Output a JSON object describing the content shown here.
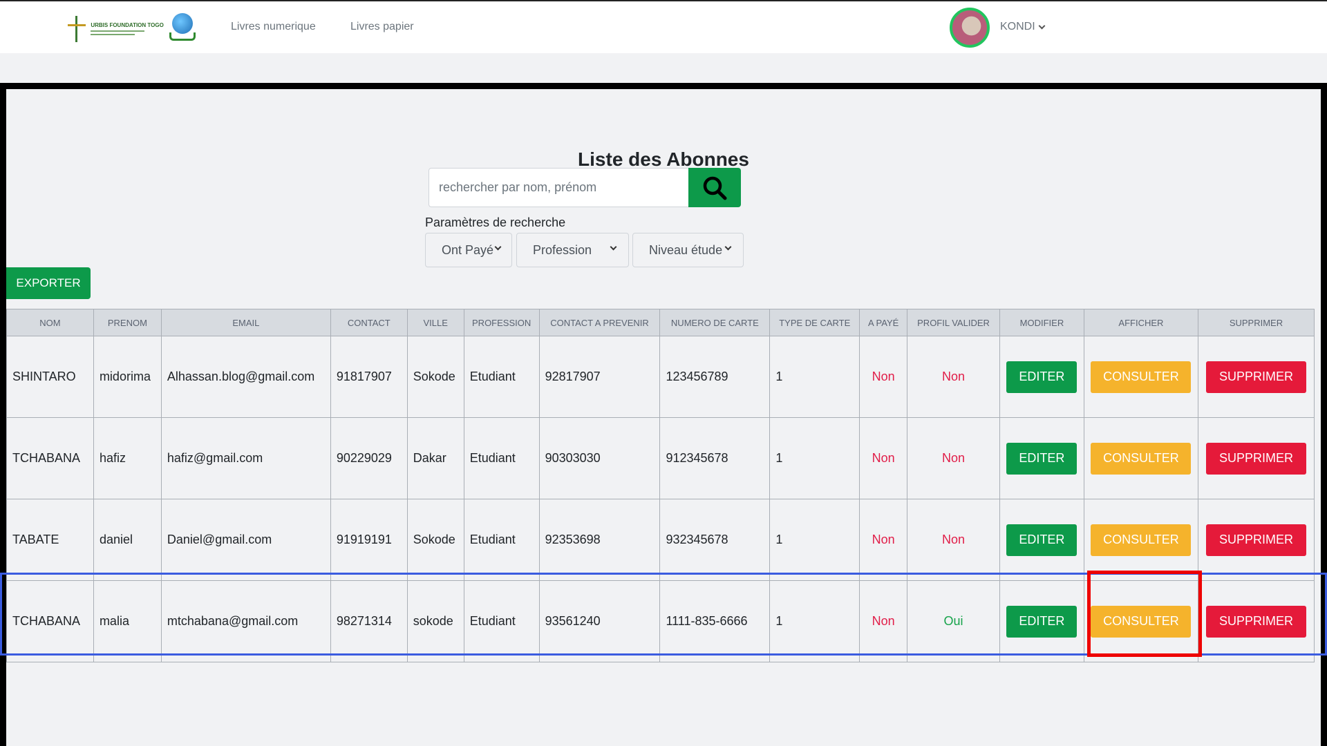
{
  "navbar": {
    "logo": {
      "title": "URBIS FOUNDATION TOGO",
      "icon": "logo-emblem-icon",
      "globe_icon": "globe-book-icon"
    },
    "links": [
      "Livres numerique",
      "Livres papier"
    ],
    "user": {
      "name": "KONDI",
      "avatar_icon": "user-avatar-icon"
    }
  },
  "page": {
    "title": "Liste des Abonnes",
    "search": {
      "placeholder": "rechercher par nom, prénom",
      "value": "",
      "icon": "search-icon"
    },
    "params_label": "Paramètres de recherche",
    "filters": [
      "Ont Payé",
      "Profession",
      "Niveau étude"
    ],
    "export_label": "EXPORTER"
  },
  "table": {
    "headers": [
      "NOM",
      "PRENOM",
      "EMAIL",
      "CONTACT",
      "VILLE",
      "PROFESSION",
      "CONTACT A PREVENIR",
      "NUMERO DE CARTE",
      "TYPE DE CARTE",
      "A PAYÉ",
      "PROFIL VALIDER",
      "MODIFIER",
      "AFFICHER",
      "SUPPRIMER"
    ],
    "rows": [
      {
        "nom": "SHINTARO",
        "prenom": "midorima",
        "email": "Alhassan.blog@gmail.com",
        "contact": "91817907",
        "ville": "Sokode",
        "profession": "Etudiant",
        "contact_prevenir": "92817907",
        "numero_carte": "123456789",
        "type_carte": "1",
        "a_paye": "Non",
        "profil_valider": "Non",
        "edit": "EDITER",
        "view": "CONSULTER",
        "delete": "SUPPRIMER"
      },
      {
        "nom": "TCHABANA",
        "prenom": "hafiz",
        "email": "hafiz@gmail.com",
        "contact": "90229029",
        "ville": "Dakar",
        "profession": "Etudiant",
        "contact_prevenir": "90303030",
        "numero_carte": "912345678",
        "type_carte": "1",
        "a_paye": "Non",
        "profil_valider": "Non",
        "edit": "EDITER",
        "view": "CONSULTER",
        "delete": "SUPPRIMER"
      },
      {
        "nom": "TABATE",
        "prenom": "daniel",
        "email": "Daniel@gmail.com",
        "contact": "91919191",
        "ville": "Sokode",
        "profession": "Etudiant",
        "contact_prevenir": "92353698",
        "numero_carte": "932345678",
        "type_carte": "1",
        "a_paye": "Non",
        "profil_valider": "Non",
        "edit": "EDITER",
        "view": "CONSULTER",
        "delete": "SUPPRIMER"
      },
      {
        "nom": "TCHABANA",
        "prenom": "malia",
        "email": "mtchabana@gmail.com",
        "contact": "98271314",
        "ville": "sokode",
        "profession": "Etudiant",
        "contact_prevenir": "93561240",
        "numero_carte": "1111-835-6666",
        "type_carte": "1",
        "a_paye": "Non",
        "profil_valider": "Oui",
        "edit": "EDITER",
        "view": "CONSULTER",
        "delete": "SUPPRIMER"
      }
    ]
  },
  "colors": {
    "primary_green": "#0d9a4a",
    "warning_yellow": "#f5b32c",
    "danger_red": "#e51a3a",
    "status_no": "#e11d48",
    "status_yes": "#16a34a",
    "row_highlight": "#3b5ce0",
    "cell_highlight": "#ee0000"
  }
}
